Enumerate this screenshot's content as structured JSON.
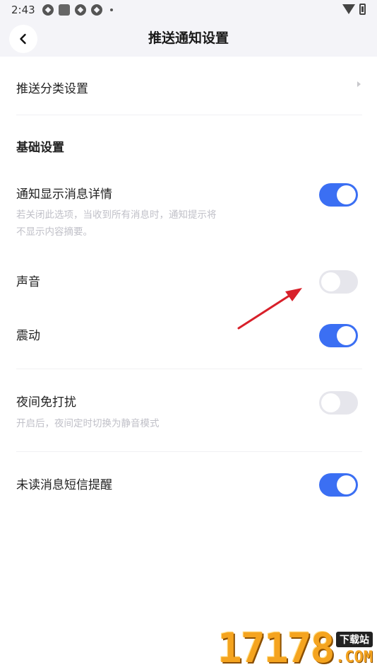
{
  "status_bar": {
    "time": "2:43",
    "icons": [
      "app-icon",
      "square-icon",
      "app-icon",
      "app-icon",
      "dot-icon"
    ],
    "right_icons": [
      "wifi-icon",
      "battery-icon"
    ]
  },
  "header": {
    "title": "推送通知设置",
    "back_icon": "chevron-left-icon"
  },
  "push_category": {
    "label": "推送分类设置",
    "icon": "chevron-right-icon"
  },
  "basic_section": {
    "title": "基础设置"
  },
  "settings": [
    {
      "label": "通知显示消息详情",
      "description": "若关闭此选项，当收到所有消息时，通知提示将不显示内容摘要。",
      "enabled": true
    },
    {
      "label": "声音",
      "description": "",
      "enabled": false
    },
    {
      "label": "震动",
      "description": "",
      "enabled": true
    },
    {
      "label": "夜间免打扰",
      "description": "开启后，夜间定时切换为静音模式",
      "enabled": false
    },
    {
      "label": "未读消息短信提醒",
      "description": "",
      "enabled": true
    }
  ],
  "colors": {
    "toggle_on": "#3b6ff3",
    "toggle_off": "#e6e6ec",
    "arrow": "#d8202a",
    "header_bg": "#f4f4f8"
  },
  "watermark": {
    "digits": "17178",
    "badge": "下载站",
    "suffix": ".COM"
  }
}
